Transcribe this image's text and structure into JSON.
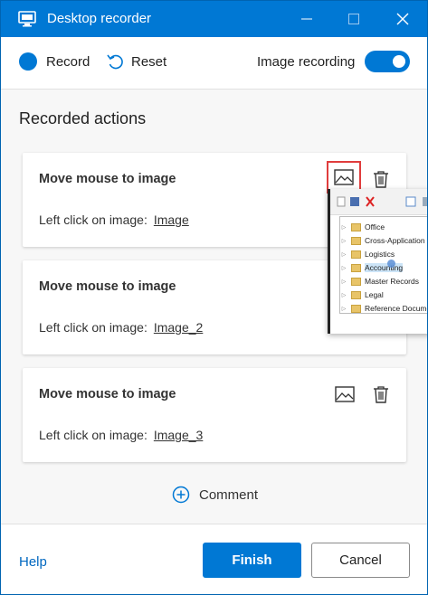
{
  "window": {
    "title": "Desktop recorder"
  },
  "toolbar": {
    "record_label": "Record",
    "reset_label": "Reset",
    "image_recording_label": "Image recording",
    "image_recording_enabled": true
  },
  "main": {
    "section_title": "Recorded actions",
    "actions": [
      {
        "title": "Move mouse to image",
        "desc": "Left click on image:",
        "link": "Image"
      },
      {
        "title": "Move mouse to image",
        "desc": "Left click on image:",
        "link": "Image_2"
      },
      {
        "title": "Move mouse to image",
        "desc": "Left click on image:",
        "link": "Image_3"
      }
    ],
    "comment_label": "Comment"
  },
  "preview": {
    "tree_items": [
      "Office",
      "Cross-Application",
      "Logistics",
      "Accounting",
      "Master Records",
      "Legal",
      "Reference Documents"
    ]
  },
  "footer": {
    "help_label": "Help",
    "finish_label": "Finish",
    "cancel_label": "Cancel"
  },
  "colors": {
    "accent": "#0078d4",
    "highlight_border": "#e03d3d"
  },
  "icons": {
    "app": "monitor-icon",
    "image": "image-icon",
    "delete": "trash-icon",
    "comment": "plus-circle-icon",
    "reset": "undo-arrow-icon"
  }
}
